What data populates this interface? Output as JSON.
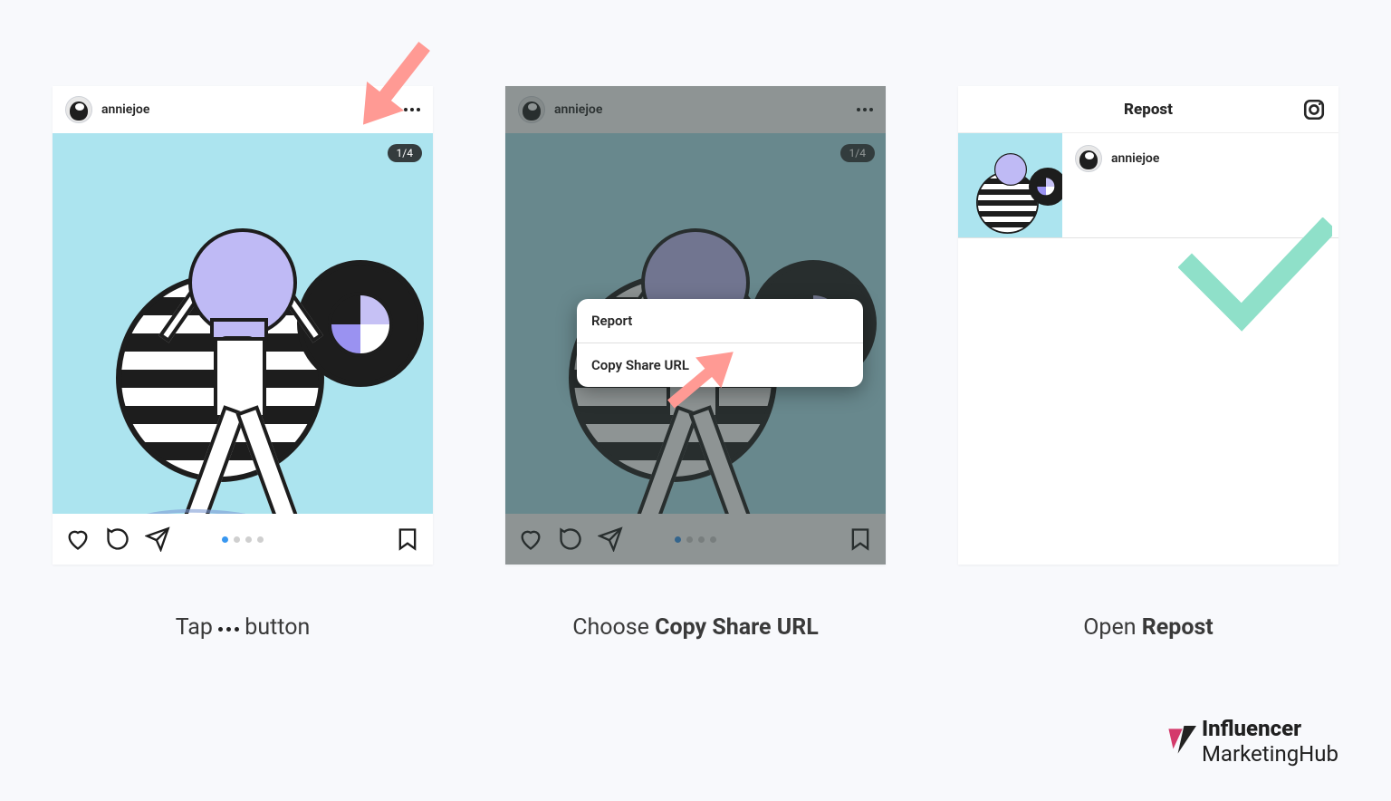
{
  "username": "anniejoe",
  "counter": "1/4",
  "sheet": {
    "opt1": "Report",
    "opt2": "Copy Share URL"
  },
  "repost": {
    "title": "Repost",
    "user": "anniejoe"
  },
  "captions": {
    "c1a": "Tap ",
    "c1b": " button",
    "c2a": "Choose ",
    "c2b": "Copy Share URL",
    "c3a": "Open ",
    "c3b": "Repost"
  },
  "brand": {
    "a": "Influencer",
    "b": "Marketing",
    "c": "Hub"
  }
}
